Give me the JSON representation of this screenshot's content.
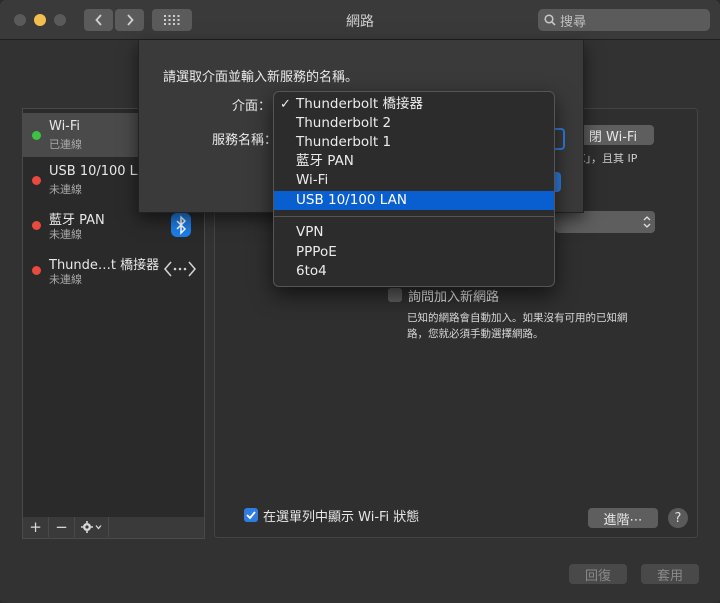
{
  "window": {
    "title": "網路"
  },
  "titlebar": {
    "search_placeholder": "搜尋"
  },
  "services": [
    {
      "name": "Wi-Fi",
      "status": "已連線",
      "status_color": "#3ec244",
      "icon": "wifi-icon"
    },
    {
      "name": "USB 10/100 LAN",
      "status": "未連線",
      "status_color": "#e84a3f",
      "icon": "ethernet-icon"
    },
    {
      "name": "藍牙 PAN",
      "status": "未連線",
      "status_color": "#e84a3f",
      "icon": "bluetooth-icon"
    },
    {
      "name": "Thunde…t 橋接器",
      "status": "未連線",
      "status_color": "#e84a3f",
      "icon": "thunderbolt-bridge-icon"
    }
  ],
  "list_footer": {
    "add": "+",
    "remove": "−"
  },
  "panel": {
    "turn_off_wifi": "閉 Wi-Fi",
    "status_fragment": "X」，且其 IP",
    "ask_join_label": "詢問加入新網路",
    "ask_join_desc": "已知的網路會自動加入。如果沒有可用的已知網路，您就必須手動選擇網路。",
    "show_in_menubar": "在選單列中顯示 Wi-Fi 狀態",
    "advanced": "進階⋯",
    "help": "?",
    "revert": "回復",
    "apply": "套用"
  },
  "sheet": {
    "prompt": "請選取介面並輸入新服務的名稱。",
    "interface_label": "介面：",
    "service_name_label": "服務名稱："
  },
  "menu": {
    "group1": [
      {
        "label": "Thunderbolt 橋接器",
        "checked": true
      },
      {
        "label": "Thunderbolt 2",
        "checked": false
      },
      {
        "label": "Thunderbolt 1",
        "checked": false
      },
      {
        "label": "藍牙 PAN",
        "checked": false
      },
      {
        "label": "Wi-Fi",
        "checked": false
      },
      {
        "label": "USB 10/100 LAN",
        "checked": false,
        "highlighted": true
      }
    ],
    "group2": [
      {
        "label": "VPN"
      },
      {
        "label": "PPPoE"
      },
      {
        "label": "6to4"
      }
    ]
  },
  "colors": {
    "accent": "#0a5fd0",
    "checkbox_checked": "#2f7de1"
  }
}
